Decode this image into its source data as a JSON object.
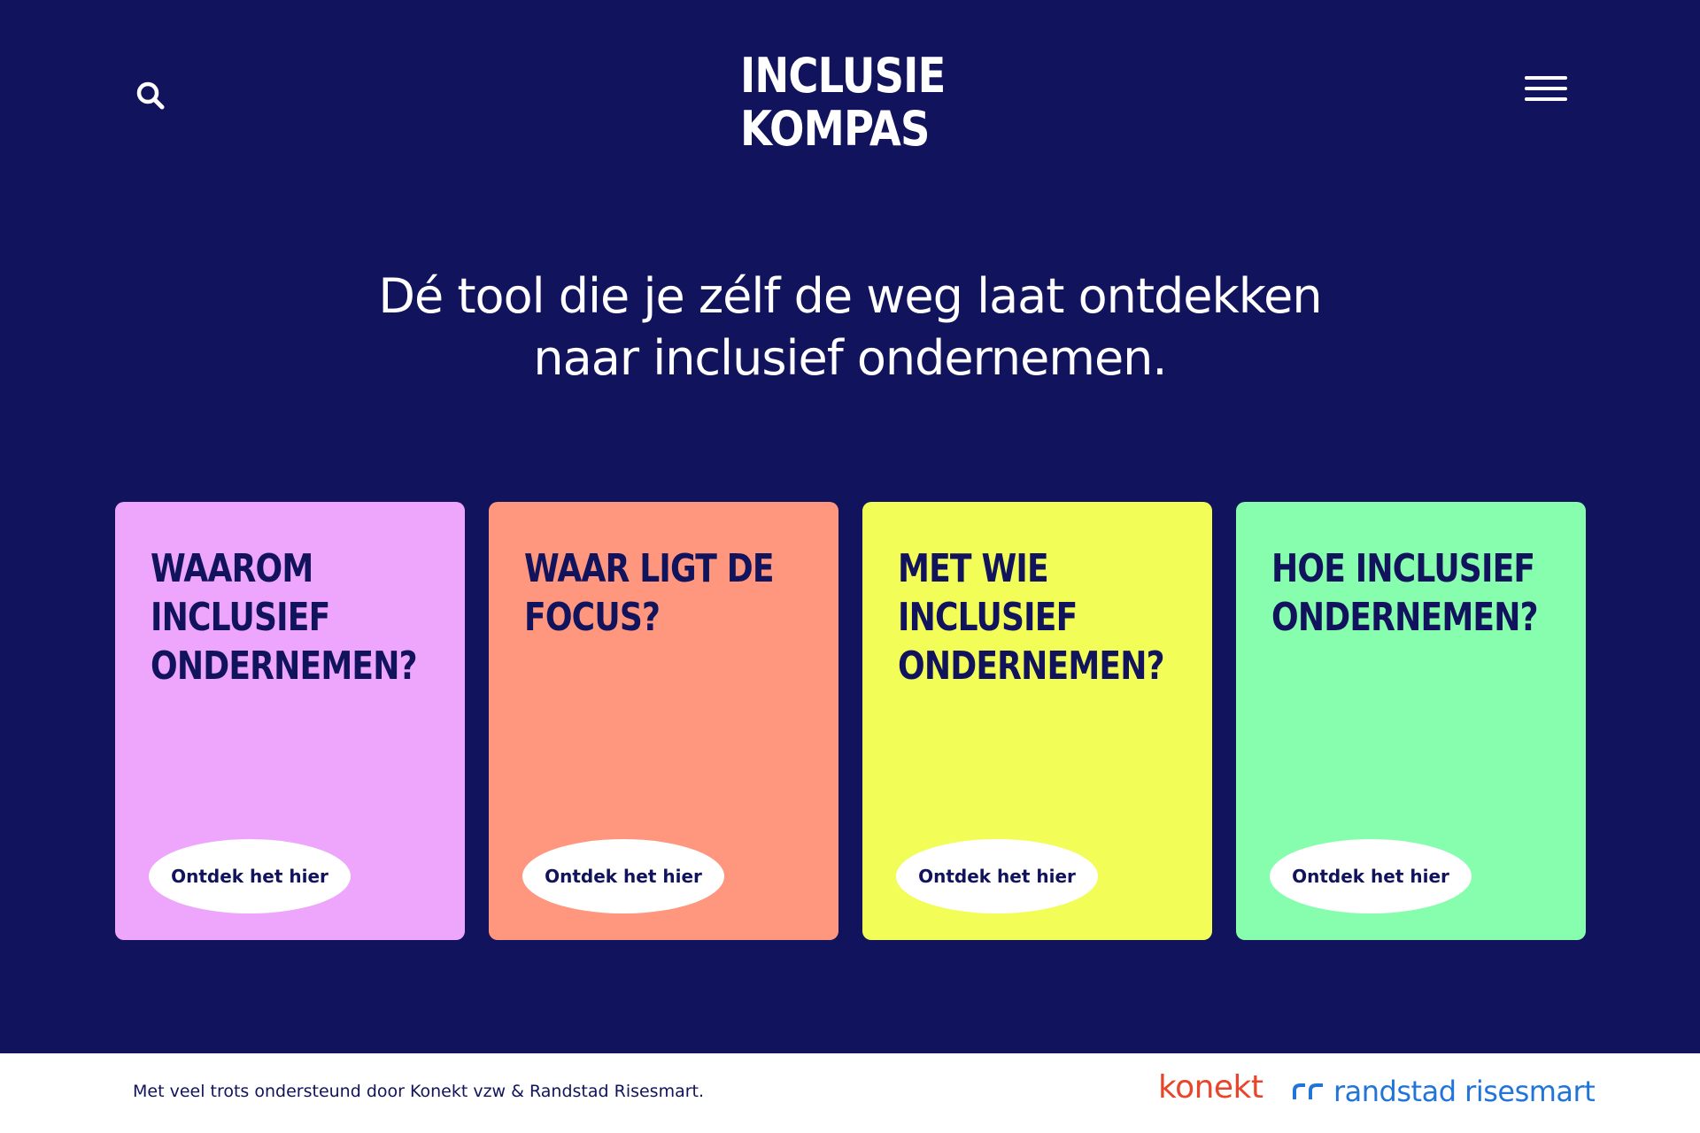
{
  "header": {
    "logo_line1": "INCLUSIE",
    "logo_line2": "KOMPAS"
  },
  "hero": {
    "line1": "Dé tool die je zélf de weg laat ontdekken",
    "line2": "naar inclusief ondernemen."
  },
  "cards": [
    {
      "title_lines": [
        "WAAROM",
        "INCLUSIEF",
        "ONDERNEMEN?"
      ],
      "button_label": "Ontdek het hier",
      "color": "#eda6fb"
    },
    {
      "title_lines": [
        "WAAR LIGT DE",
        "FOCUS?"
      ],
      "button_label": "Ontdek het hier",
      "color": "#ff967e"
    },
    {
      "title_lines": [
        "MET WIE",
        "INCLUSIEF",
        "ONDERNEMEN?"
      ],
      "button_label": "Ontdek het hier",
      "color": "#f2fd58"
    },
    {
      "title_lines": [
        "HOE INCLUSIEF",
        "ONDERNEMEN?"
      ],
      "button_label": "Ontdek het hier",
      "color": "#86feae"
    }
  ],
  "footer": {
    "text": "Met veel trots ondersteund door Konekt vzw & Randstad Risesmart.",
    "konekt_logo": "konekt",
    "randstad_logo": "randstad risesmart"
  },
  "colors": {
    "background": "#11135c",
    "text_dark": "#11135c",
    "konekt": "#e8452a",
    "randstad": "#2175d9"
  },
  "icons": {
    "search": "search-icon",
    "menu": "hamburger-menu-icon"
  }
}
